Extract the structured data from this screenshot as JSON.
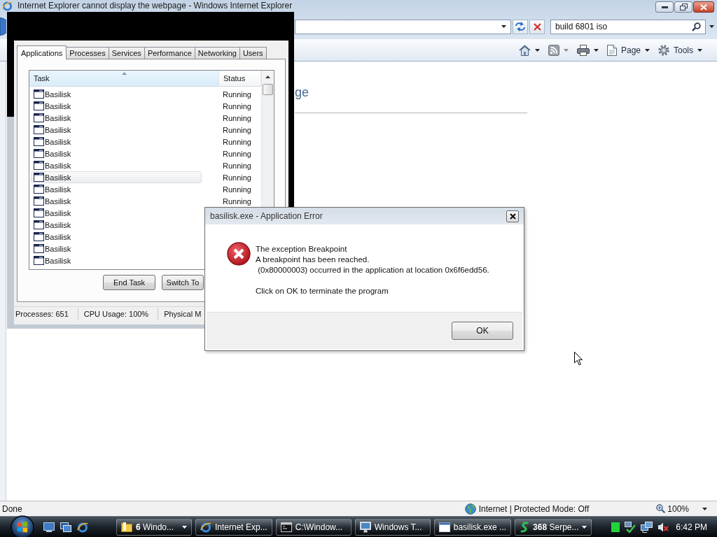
{
  "ie_window": {
    "title": "Internet Explorer cannot display the webpage - Windows Internet Explorer",
    "search_field": {
      "value": "build 6801 iso"
    },
    "command_bar": {
      "feeds_button": {
        "disabled": true
      },
      "page_menu": "Page",
      "tools_menu": "Tools"
    },
    "page": {
      "heading": "ge"
    },
    "status_bar": {
      "status": "Done",
      "zone": "Internet | Protected Mode: Off",
      "zoom": "100%"
    }
  },
  "task_manager": {
    "tabs": [
      {
        "label": "Applications",
        "selected": true
      },
      {
        "label": "Processes",
        "selected": false
      },
      {
        "label": "Services",
        "selected": false
      },
      {
        "label": "Performance",
        "selected": false
      },
      {
        "label": "Networking",
        "selected": false
      },
      {
        "label": "Users",
        "selected": false
      }
    ],
    "columns": {
      "task": "Task",
      "status": "Status"
    },
    "rows": [
      {
        "task": "Basilisk",
        "status": "Running",
        "hovered": false
      },
      {
        "task": "Basilisk",
        "status": "Running",
        "hovered": false
      },
      {
        "task": "Basilisk",
        "status": "Running",
        "hovered": false
      },
      {
        "task": "Basilisk",
        "status": "Running",
        "hovered": false
      },
      {
        "task": "Basilisk",
        "status": "Running",
        "hovered": false
      },
      {
        "task": "Basilisk",
        "status": "Running",
        "hovered": false
      },
      {
        "task": "Basilisk",
        "status": "Running",
        "hovered": false
      },
      {
        "task": "Basilisk",
        "status": "Running",
        "hovered": true
      },
      {
        "task": "Basilisk",
        "status": "Running",
        "hovered": false
      },
      {
        "task": "Basilisk",
        "status": "Running",
        "hovered": false
      },
      {
        "task": "Basilisk",
        "hovered": false
      },
      {
        "task": "Basilisk",
        "hovered": false
      },
      {
        "task": "Basilisk",
        "hovered": false
      },
      {
        "task": "Basilisk",
        "hovered": false
      },
      {
        "task": "Basilisk",
        "hovered": false
      }
    ],
    "buttons": [
      "End Task",
      "Switch To"
    ],
    "status_bar": [
      "Processes: 651",
      "CPU Usage: 100%",
      "Physical M"
    ]
  },
  "error_dialog": {
    "title": "basilisk.exe - Application Error",
    "message": [
      "The exception Breakpoint\nA breakpoint has been reached.\n (0x80000003) occurred in the application at location 0x6f6edd56.",
      "Click on OK to terminate the program"
    ],
    "button": "OK"
  },
  "taskbar": {
    "buttons": [
      {
        "kind": "folder",
        "label": "**6** Windo...",
        "grouped": true
      },
      {
        "kind": "browser",
        "label": "Internet Exp...",
        "grouped": false
      },
      {
        "kind": "console",
        "label": "C:\\Window...",
        "grouped": false
      },
      {
        "kind": "monitor",
        "label": "Windows T...",
        "grouped": false
      },
      {
        "kind": "app",
        "label": "basilisk.exe ...",
        "grouped": false
      },
      {
        "kind": "serpent",
        "label": "**368** Serpe...",
        "grouped": true
      }
    ],
    "tray": {
      "volume_muted": true,
      "clock": "6:42 PM"
    }
  }
}
